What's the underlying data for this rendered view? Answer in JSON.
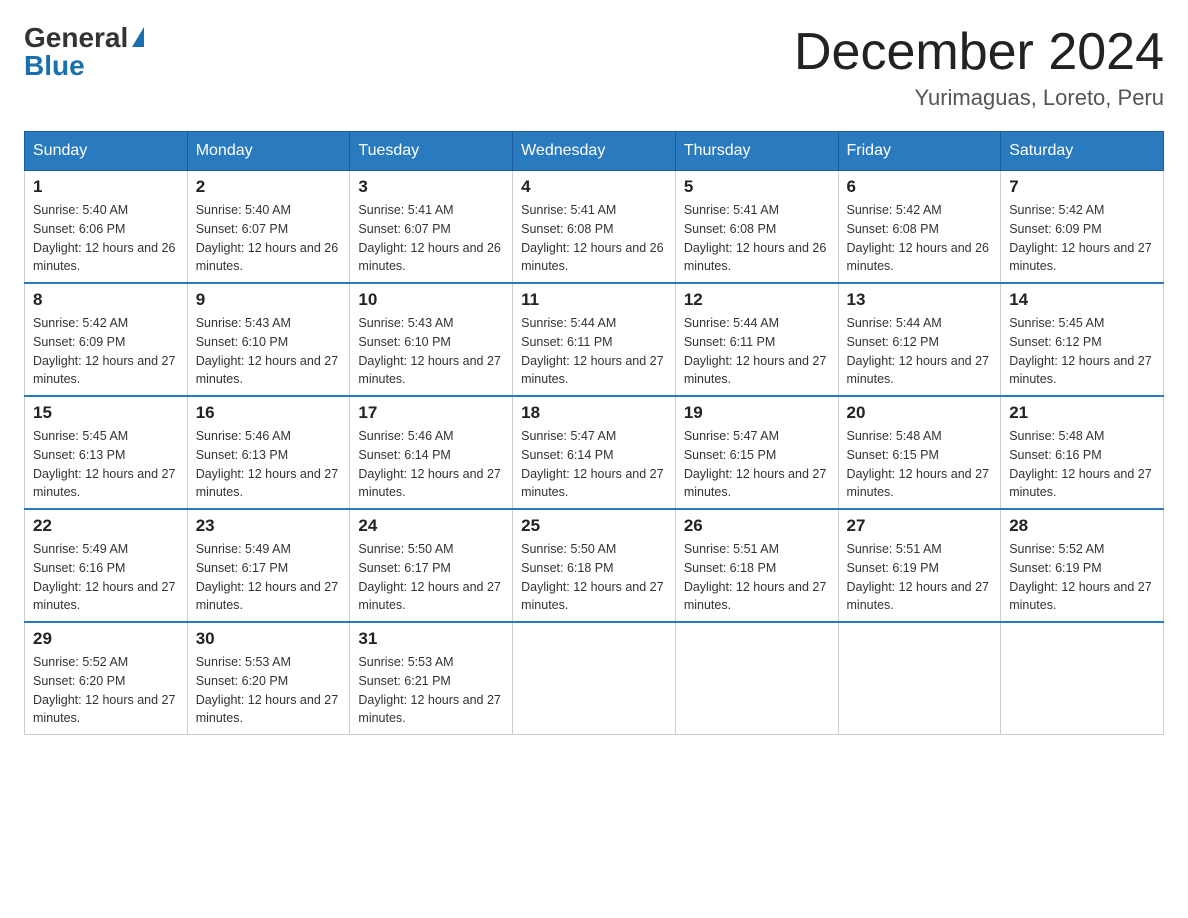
{
  "logo": {
    "general": "General",
    "blue": "Blue"
  },
  "title": "December 2024",
  "subtitle": "Yurimaguas, Loreto, Peru",
  "days_of_week": [
    "Sunday",
    "Monday",
    "Tuesday",
    "Wednesday",
    "Thursday",
    "Friday",
    "Saturday"
  ],
  "weeks": [
    [
      {
        "day": "1",
        "sunrise": "5:40 AM",
        "sunset": "6:06 PM",
        "daylight": "12 hours and 26 minutes."
      },
      {
        "day": "2",
        "sunrise": "5:40 AM",
        "sunset": "6:07 PM",
        "daylight": "12 hours and 26 minutes."
      },
      {
        "day": "3",
        "sunrise": "5:41 AM",
        "sunset": "6:07 PM",
        "daylight": "12 hours and 26 minutes."
      },
      {
        "day": "4",
        "sunrise": "5:41 AM",
        "sunset": "6:08 PM",
        "daylight": "12 hours and 26 minutes."
      },
      {
        "day": "5",
        "sunrise": "5:41 AM",
        "sunset": "6:08 PM",
        "daylight": "12 hours and 26 minutes."
      },
      {
        "day": "6",
        "sunrise": "5:42 AM",
        "sunset": "6:08 PM",
        "daylight": "12 hours and 26 minutes."
      },
      {
        "day": "7",
        "sunrise": "5:42 AM",
        "sunset": "6:09 PM",
        "daylight": "12 hours and 27 minutes."
      }
    ],
    [
      {
        "day": "8",
        "sunrise": "5:42 AM",
        "sunset": "6:09 PM",
        "daylight": "12 hours and 27 minutes."
      },
      {
        "day": "9",
        "sunrise": "5:43 AM",
        "sunset": "6:10 PM",
        "daylight": "12 hours and 27 minutes."
      },
      {
        "day": "10",
        "sunrise": "5:43 AM",
        "sunset": "6:10 PM",
        "daylight": "12 hours and 27 minutes."
      },
      {
        "day": "11",
        "sunrise": "5:44 AM",
        "sunset": "6:11 PM",
        "daylight": "12 hours and 27 minutes."
      },
      {
        "day": "12",
        "sunrise": "5:44 AM",
        "sunset": "6:11 PM",
        "daylight": "12 hours and 27 minutes."
      },
      {
        "day": "13",
        "sunrise": "5:44 AM",
        "sunset": "6:12 PM",
        "daylight": "12 hours and 27 minutes."
      },
      {
        "day": "14",
        "sunrise": "5:45 AM",
        "sunset": "6:12 PM",
        "daylight": "12 hours and 27 minutes."
      }
    ],
    [
      {
        "day": "15",
        "sunrise": "5:45 AM",
        "sunset": "6:13 PM",
        "daylight": "12 hours and 27 minutes."
      },
      {
        "day": "16",
        "sunrise": "5:46 AM",
        "sunset": "6:13 PM",
        "daylight": "12 hours and 27 minutes."
      },
      {
        "day": "17",
        "sunrise": "5:46 AM",
        "sunset": "6:14 PM",
        "daylight": "12 hours and 27 minutes."
      },
      {
        "day": "18",
        "sunrise": "5:47 AM",
        "sunset": "6:14 PM",
        "daylight": "12 hours and 27 minutes."
      },
      {
        "day": "19",
        "sunrise": "5:47 AM",
        "sunset": "6:15 PM",
        "daylight": "12 hours and 27 minutes."
      },
      {
        "day": "20",
        "sunrise": "5:48 AM",
        "sunset": "6:15 PM",
        "daylight": "12 hours and 27 minutes."
      },
      {
        "day": "21",
        "sunrise": "5:48 AM",
        "sunset": "6:16 PM",
        "daylight": "12 hours and 27 minutes."
      }
    ],
    [
      {
        "day": "22",
        "sunrise": "5:49 AM",
        "sunset": "6:16 PM",
        "daylight": "12 hours and 27 minutes."
      },
      {
        "day": "23",
        "sunrise": "5:49 AM",
        "sunset": "6:17 PM",
        "daylight": "12 hours and 27 minutes."
      },
      {
        "day": "24",
        "sunrise": "5:50 AM",
        "sunset": "6:17 PM",
        "daylight": "12 hours and 27 minutes."
      },
      {
        "day": "25",
        "sunrise": "5:50 AM",
        "sunset": "6:18 PM",
        "daylight": "12 hours and 27 minutes."
      },
      {
        "day": "26",
        "sunrise": "5:51 AM",
        "sunset": "6:18 PM",
        "daylight": "12 hours and 27 minutes."
      },
      {
        "day": "27",
        "sunrise": "5:51 AM",
        "sunset": "6:19 PM",
        "daylight": "12 hours and 27 minutes."
      },
      {
        "day": "28",
        "sunrise": "5:52 AM",
        "sunset": "6:19 PM",
        "daylight": "12 hours and 27 minutes."
      }
    ],
    [
      {
        "day": "29",
        "sunrise": "5:52 AM",
        "sunset": "6:20 PM",
        "daylight": "12 hours and 27 minutes."
      },
      {
        "day": "30",
        "sunrise": "5:53 AM",
        "sunset": "6:20 PM",
        "daylight": "12 hours and 27 minutes."
      },
      {
        "day": "31",
        "sunrise": "5:53 AM",
        "sunset": "6:21 PM",
        "daylight": "12 hours and 27 minutes."
      },
      null,
      null,
      null,
      null
    ]
  ]
}
